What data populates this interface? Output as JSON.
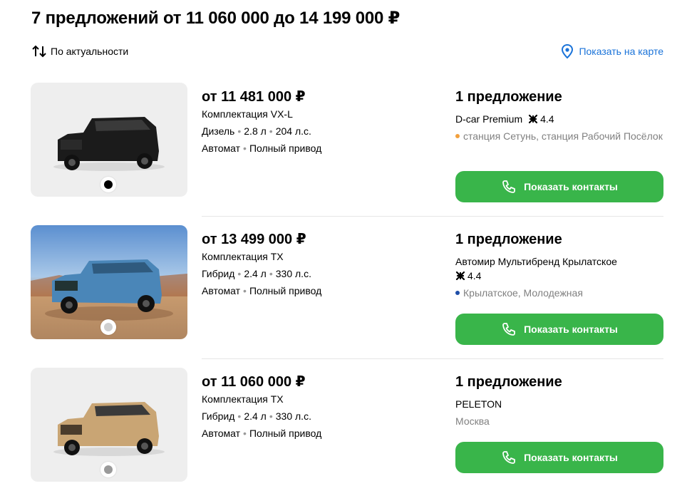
{
  "header": {
    "title": "7 предложений от 11 060 000 до 14 199 000 ₽",
    "sort_label": "По актуальности",
    "map_label": "Показать на карте"
  },
  "colors": {
    "accent": "#39b54a",
    "link": "#1a73d9",
    "muted": "#808080"
  },
  "listings": [
    {
      "price": "от 11 481 000 ₽",
      "trim": "Комплектация VX-L",
      "engine": [
        "Дизель",
        "2.8 л",
        "204 л.с."
      ],
      "drivetrain": [
        "Автомат",
        "Полный привод"
      ],
      "offers": "1 предложение",
      "dealer": "D-car Premium",
      "rating": "4.4",
      "location": "станция Сетунь, станция Рабочий Посёлок",
      "metro_color": "#f2a03d",
      "car_color": "#1b1b1b",
      "button_label": "Показать контакты"
    },
    {
      "price": "от 13 499 000 ₽",
      "trim": "Комплектация TX",
      "engine": [
        "Гибрид",
        "2.4 л",
        "330 л.с."
      ],
      "drivetrain": [
        "Автомат",
        "Полный привод"
      ],
      "offers": "1 предложение",
      "dealer": "Автомир Мультибренд Крылатское",
      "rating": "4.4",
      "location": "Крылатское, Молодежная",
      "metro_color": "#1f4ea8",
      "car_color": "#4a86b8",
      "button_label": "Показать контакты"
    },
    {
      "price": "от 11 060 000 ₽",
      "trim": "Комплектация TX",
      "engine": [
        "Гибрид",
        "2.4 л",
        "330 л.с."
      ],
      "drivetrain": [
        "Автомат",
        "Полный привод"
      ],
      "offers": "1 предложение",
      "dealer": "PELETON",
      "location": "Москва",
      "car_color": "#c9a574",
      "button_label": "Показать контакты"
    }
  ]
}
